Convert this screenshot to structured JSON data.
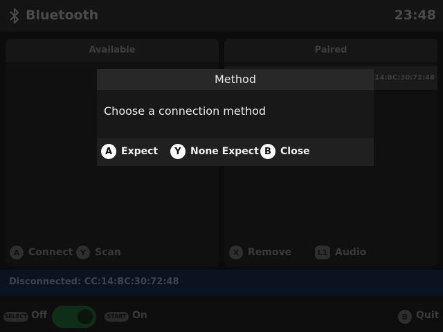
{
  "header": {
    "title": "Bluetooth",
    "clock": "23:48"
  },
  "panels": {
    "available": {
      "title": "Available"
    },
    "paired": {
      "title": "Paired",
      "device_address": "CC:14:BC:30:72:48"
    }
  },
  "hints": {
    "connect": {
      "button": "A",
      "label": "Connect"
    },
    "scan": {
      "button": "Y",
      "label": "Scan"
    },
    "remove": {
      "button": "X",
      "label": "Remove"
    },
    "audio": {
      "button": "L1",
      "label": "Audio"
    }
  },
  "status": {
    "text": "Disconnected: CC:14:BC:30:72:48"
  },
  "footer": {
    "select_button": "SELECT",
    "off_label": "Off",
    "start_button": "START",
    "on_label": "On",
    "quit_button": "B",
    "quit_label": "Quit"
  },
  "dialog": {
    "title": "Method",
    "message": "Choose a connection method",
    "actions": [
      {
        "button": "A",
        "label": "Expect"
      },
      {
        "button": "Y",
        "label": "None Expect"
      },
      {
        "button": "B",
        "label": "Close"
      }
    ]
  },
  "colors": {
    "accent_green": "#0e2e18",
    "dialog_bg": "#181818"
  },
  "icons": {
    "header": "bluetooth-icon"
  }
}
